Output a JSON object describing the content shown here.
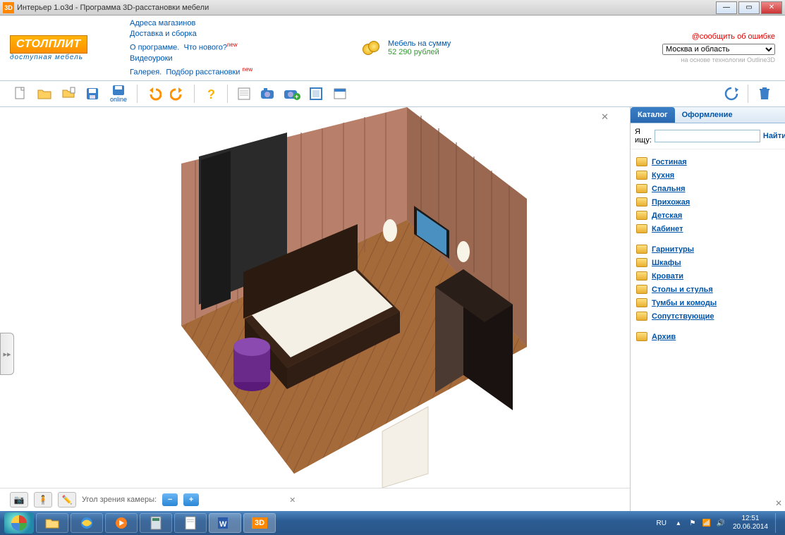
{
  "window": {
    "title": "Интерьер 1.o3d - Программа 3D-расстановки мебели",
    "icon_label": "3D"
  },
  "header": {
    "logo_main": "СТОЛПЛИТ",
    "logo_sub": "доступная мебель",
    "links": {
      "addresses": "Адреса магазинов",
      "delivery": "Доставка и сборка",
      "about": "О программе.",
      "whatsnew": "Что нового?",
      "videos": "Видеоуроки",
      "gallery": "Галерея.",
      "selection": "Подбор расстановки"
    },
    "new_badge": "new",
    "cart_label": "Мебель на сумму",
    "cart_price": "52 290 рублей",
    "report_error": "@сообщить об ошибке",
    "region": "Москва и область",
    "tech_note": "на основе технологии Outline3D"
  },
  "toolbar": {
    "online_label": "online"
  },
  "viewer": {
    "fov_label": "Угол зрения камеры:"
  },
  "sidebar": {
    "tab_catalog": "Каталог",
    "tab_design": "Оформление",
    "search_label": "Я ищу:",
    "search_button": "Найти!",
    "cats1": [
      "Гостиная",
      "Кухня",
      "Спальня",
      "Прихожая",
      "Детская",
      "Кабинет"
    ],
    "cats2": [
      "Гарнитуры",
      "Шкафы",
      "Кровати",
      "Столы и стулья",
      "Тумбы и комоды",
      "Сопутствующие"
    ],
    "cats3": [
      "Архив"
    ]
  },
  "taskbar": {
    "lang": "RU",
    "time": "12:51",
    "date": "20.06.2014"
  }
}
